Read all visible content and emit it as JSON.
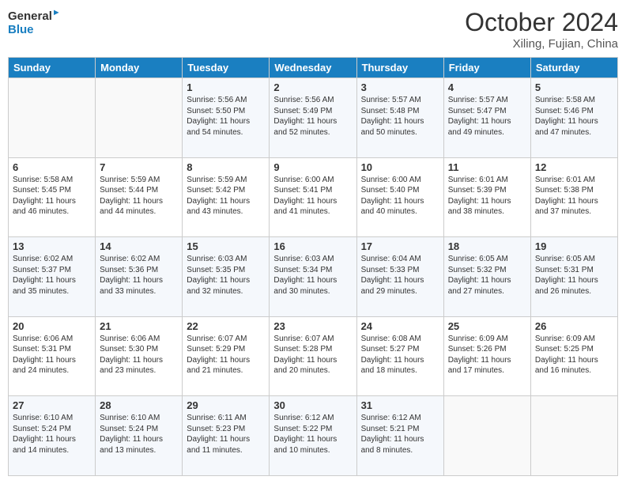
{
  "logo": {
    "line1": "General",
    "line2": "Blue"
  },
  "title": "October 2024",
  "location": "Xiling, Fujian, China",
  "days_of_week": [
    "Sunday",
    "Monday",
    "Tuesday",
    "Wednesday",
    "Thursday",
    "Friday",
    "Saturday"
  ],
  "weeks": [
    [
      {
        "day": "",
        "content": ""
      },
      {
        "day": "",
        "content": ""
      },
      {
        "day": "1",
        "content": "Sunrise: 5:56 AM\nSunset: 5:50 PM\nDaylight: 11 hours and 54 minutes."
      },
      {
        "day": "2",
        "content": "Sunrise: 5:56 AM\nSunset: 5:49 PM\nDaylight: 11 hours and 52 minutes."
      },
      {
        "day": "3",
        "content": "Sunrise: 5:57 AM\nSunset: 5:48 PM\nDaylight: 11 hours and 50 minutes."
      },
      {
        "day": "4",
        "content": "Sunrise: 5:57 AM\nSunset: 5:47 PM\nDaylight: 11 hours and 49 minutes."
      },
      {
        "day": "5",
        "content": "Sunrise: 5:58 AM\nSunset: 5:46 PM\nDaylight: 11 hours and 47 minutes."
      }
    ],
    [
      {
        "day": "6",
        "content": "Sunrise: 5:58 AM\nSunset: 5:45 PM\nDaylight: 11 hours and 46 minutes."
      },
      {
        "day": "7",
        "content": "Sunrise: 5:59 AM\nSunset: 5:44 PM\nDaylight: 11 hours and 44 minutes."
      },
      {
        "day": "8",
        "content": "Sunrise: 5:59 AM\nSunset: 5:42 PM\nDaylight: 11 hours and 43 minutes."
      },
      {
        "day": "9",
        "content": "Sunrise: 6:00 AM\nSunset: 5:41 PM\nDaylight: 11 hours and 41 minutes."
      },
      {
        "day": "10",
        "content": "Sunrise: 6:00 AM\nSunset: 5:40 PM\nDaylight: 11 hours and 40 minutes."
      },
      {
        "day": "11",
        "content": "Sunrise: 6:01 AM\nSunset: 5:39 PM\nDaylight: 11 hours and 38 minutes."
      },
      {
        "day": "12",
        "content": "Sunrise: 6:01 AM\nSunset: 5:38 PM\nDaylight: 11 hours and 37 minutes."
      }
    ],
    [
      {
        "day": "13",
        "content": "Sunrise: 6:02 AM\nSunset: 5:37 PM\nDaylight: 11 hours and 35 minutes."
      },
      {
        "day": "14",
        "content": "Sunrise: 6:02 AM\nSunset: 5:36 PM\nDaylight: 11 hours and 33 minutes."
      },
      {
        "day": "15",
        "content": "Sunrise: 6:03 AM\nSunset: 5:35 PM\nDaylight: 11 hours and 32 minutes."
      },
      {
        "day": "16",
        "content": "Sunrise: 6:03 AM\nSunset: 5:34 PM\nDaylight: 11 hours and 30 minutes."
      },
      {
        "day": "17",
        "content": "Sunrise: 6:04 AM\nSunset: 5:33 PM\nDaylight: 11 hours and 29 minutes."
      },
      {
        "day": "18",
        "content": "Sunrise: 6:05 AM\nSunset: 5:32 PM\nDaylight: 11 hours and 27 minutes."
      },
      {
        "day": "19",
        "content": "Sunrise: 6:05 AM\nSunset: 5:31 PM\nDaylight: 11 hours and 26 minutes."
      }
    ],
    [
      {
        "day": "20",
        "content": "Sunrise: 6:06 AM\nSunset: 5:31 PM\nDaylight: 11 hours and 24 minutes."
      },
      {
        "day": "21",
        "content": "Sunrise: 6:06 AM\nSunset: 5:30 PM\nDaylight: 11 hours and 23 minutes."
      },
      {
        "day": "22",
        "content": "Sunrise: 6:07 AM\nSunset: 5:29 PM\nDaylight: 11 hours and 21 minutes."
      },
      {
        "day": "23",
        "content": "Sunrise: 6:07 AM\nSunset: 5:28 PM\nDaylight: 11 hours and 20 minutes."
      },
      {
        "day": "24",
        "content": "Sunrise: 6:08 AM\nSunset: 5:27 PM\nDaylight: 11 hours and 18 minutes."
      },
      {
        "day": "25",
        "content": "Sunrise: 6:09 AM\nSunset: 5:26 PM\nDaylight: 11 hours and 17 minutes."
      },
      {
        "day": "26",
        "content": "Sunrise: 6:09 AM\nSunset: 5:25 PM\nDaylight: 11 hours and 16 minutes."
      }
    ],
    [
      {
        "day": "27",
        "content": "Sunrise: 6:10 AM\nSunset: 5:24 PM\nDaylight: 11 hours and 14 minutes."
      },
      {
        "day": "28",
        "content": "Sunrise: 6:10 AM\nSunset: 5:24 PM\nDaylight: 11 hours and 13 minutes."
      },
      {
        "day": "29",
        "content": "Sunrise: 6:11 AM\nSunset: 5:23 PM\nDaylight: 11 hours and 11 minutes."
      },
      {
        "day": "30",
        "content": "Sunrise: 6:12 AM\nSunset: 5:22 PM\nDaylight: 11 hours and 10 minutes."
      },
      {
        "day": "31",
        "content": "Sunrise: 6:12 AM\nSunset: 5:21 PM\nDaylight: 11 hours and 8 minutes."
      },
      {
        "day": "",
        "content": ""
      },
      {
        "day": "",
        "content": ""
      }
    ]
  ]
}
